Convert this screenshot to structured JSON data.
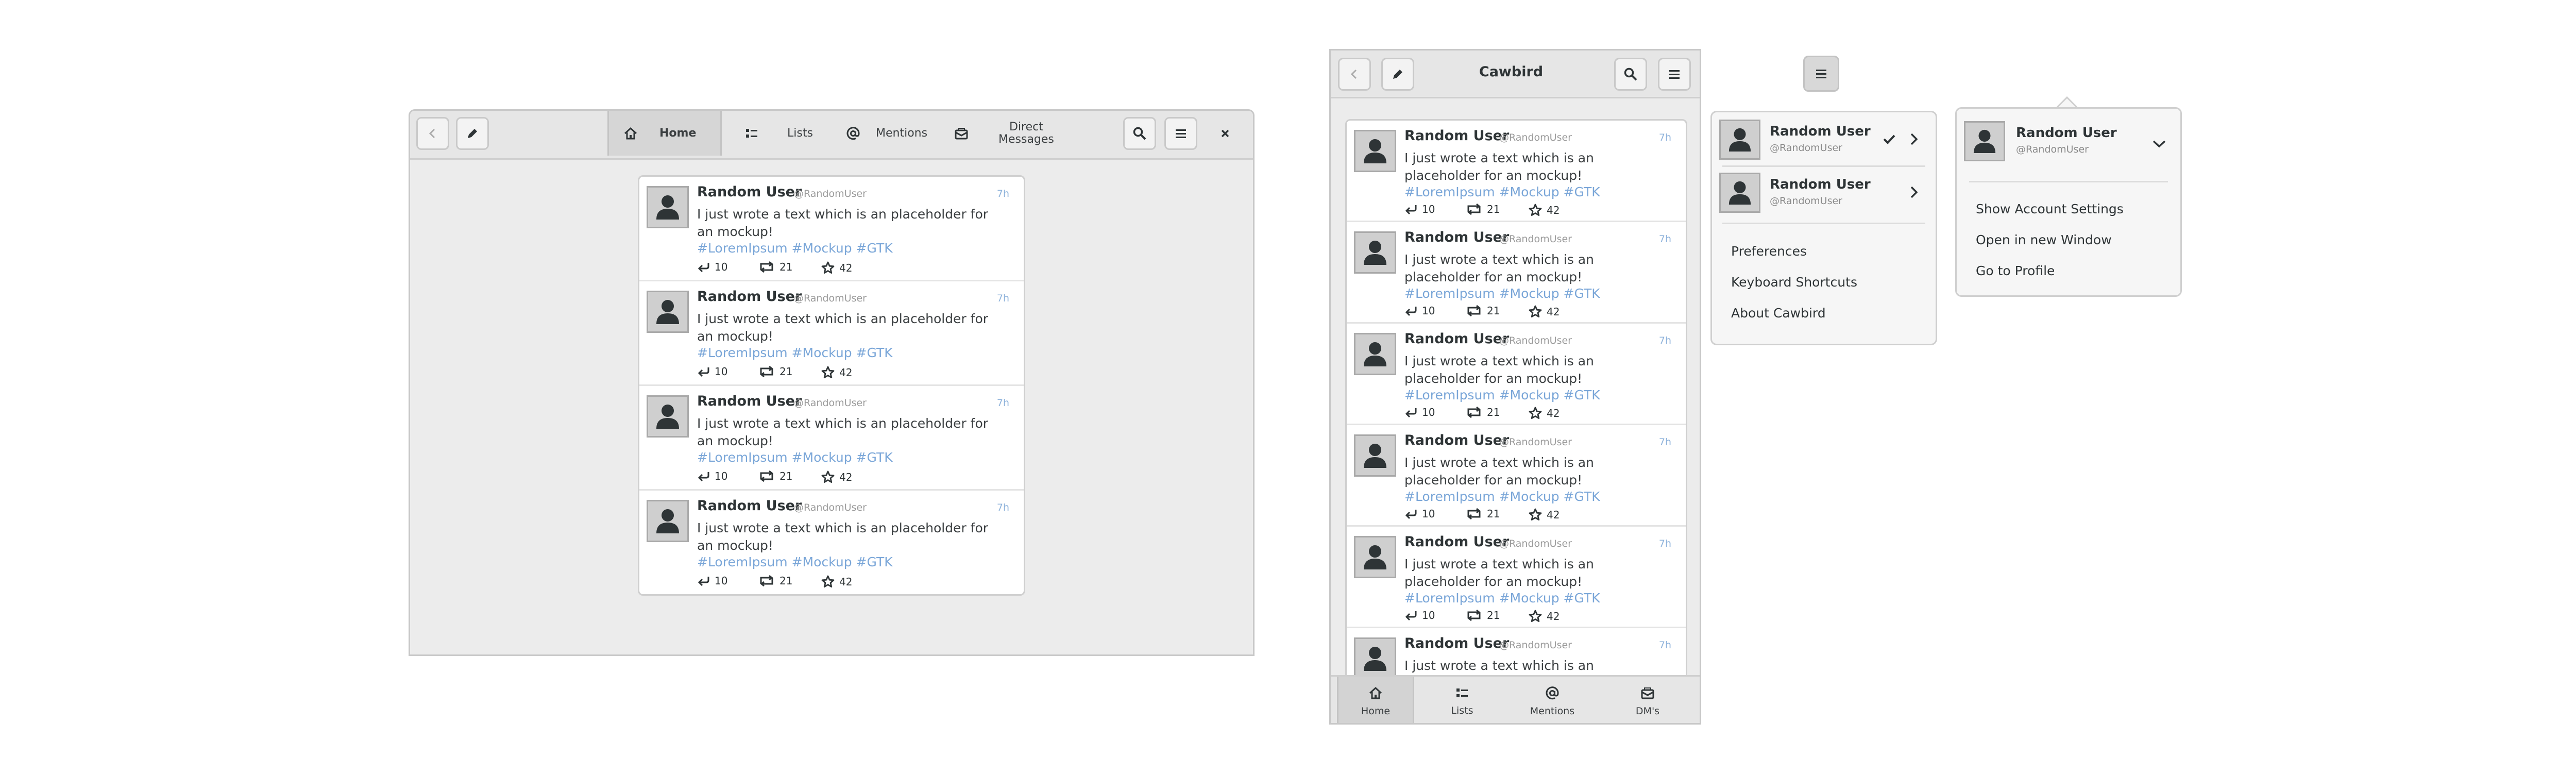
{
  "tweet": {
    "name": "Random User",
    "handle": "@RandomUser",
    "time": "7h",
    "text": "I just wrote a text which is an placeholder for an mockup!",
    "tags": "#LoremIpsum #Mockup #GTK",
    "replies": "10",
    "retweets": "21",
    "likes": "42"
  },
  "desktop": {
    "tabs": [
      {
        "label": "Home",
        "icon": "home-icon"
      },
      {
        "label": "Lists",
        "icon": "list-icon"
      },
      {
        "label": "Mentions",
        "icon": "at-icon"
      },
      {
        "label": "Direct\nMessages",
        "icon": "mail-icon"
      }
    ],
    "active_tab": "Home"
  },
  "mobile": {
    "title": "Cawbird",
    "bottom_tabs": [
      {
        "label": "Home",
        "icon": "home-icon"
      },
      {
        "label": "Lists",
        "icon": "list-icon"
      },
      {
        "label": "Mentions",
        "icon": "at-icon"
      },
      {
        "label": "DM's",
        "icon": "mail-icon"
      }
    ]
  },
  "main_menu": {
    "accounts": [
      {
        "name": "Random User",
        "handle": "@RandomUser",
        "active": true
      },
      {
        "name": "Random User",
        "handle": "@RandomUser",
        "active": false
      }
    ],
    "items": [
      "Preferences",
      "Keyboard Shortcuts",
      "About Cawbird"
    ]
  },
  "account_menu": {
    "name": "Random User",
    "handle": "@RandomUser",
    "items": [
      "Show Account Settings",
      "Open in new Window",
      "Go to Profile"
    ]
  },
  "colors": {
    "hashtag": "#7aa6d8",
    "timestamp": "#8fb3db",
    "headerbar": "#e6e6e6",
    "window_bg": "#ececec"
  }
}
